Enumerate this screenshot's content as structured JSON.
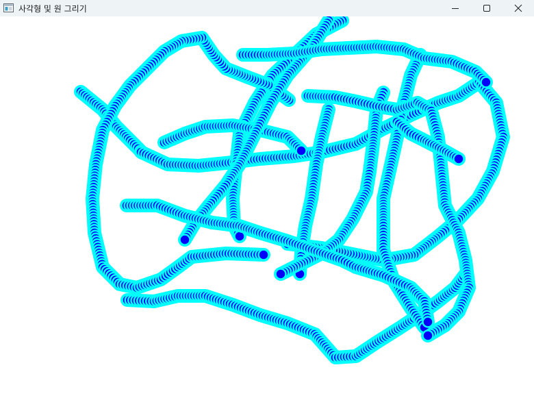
{
  "window": {
    "title": "사각형 및 원 그리기",
    "app_icon": "window-app-icon",
    "controls": [
      "minimize-icon",
      "maximize-icon",
      "close-icon"
    ]
  },
  "drawing": {
    "background": "#ffffff",
    "fill_color": "#0000ff",
    "outline_color": "#00ffff",
    "shape": "circle",
    "trail_count": 10
  }
}
